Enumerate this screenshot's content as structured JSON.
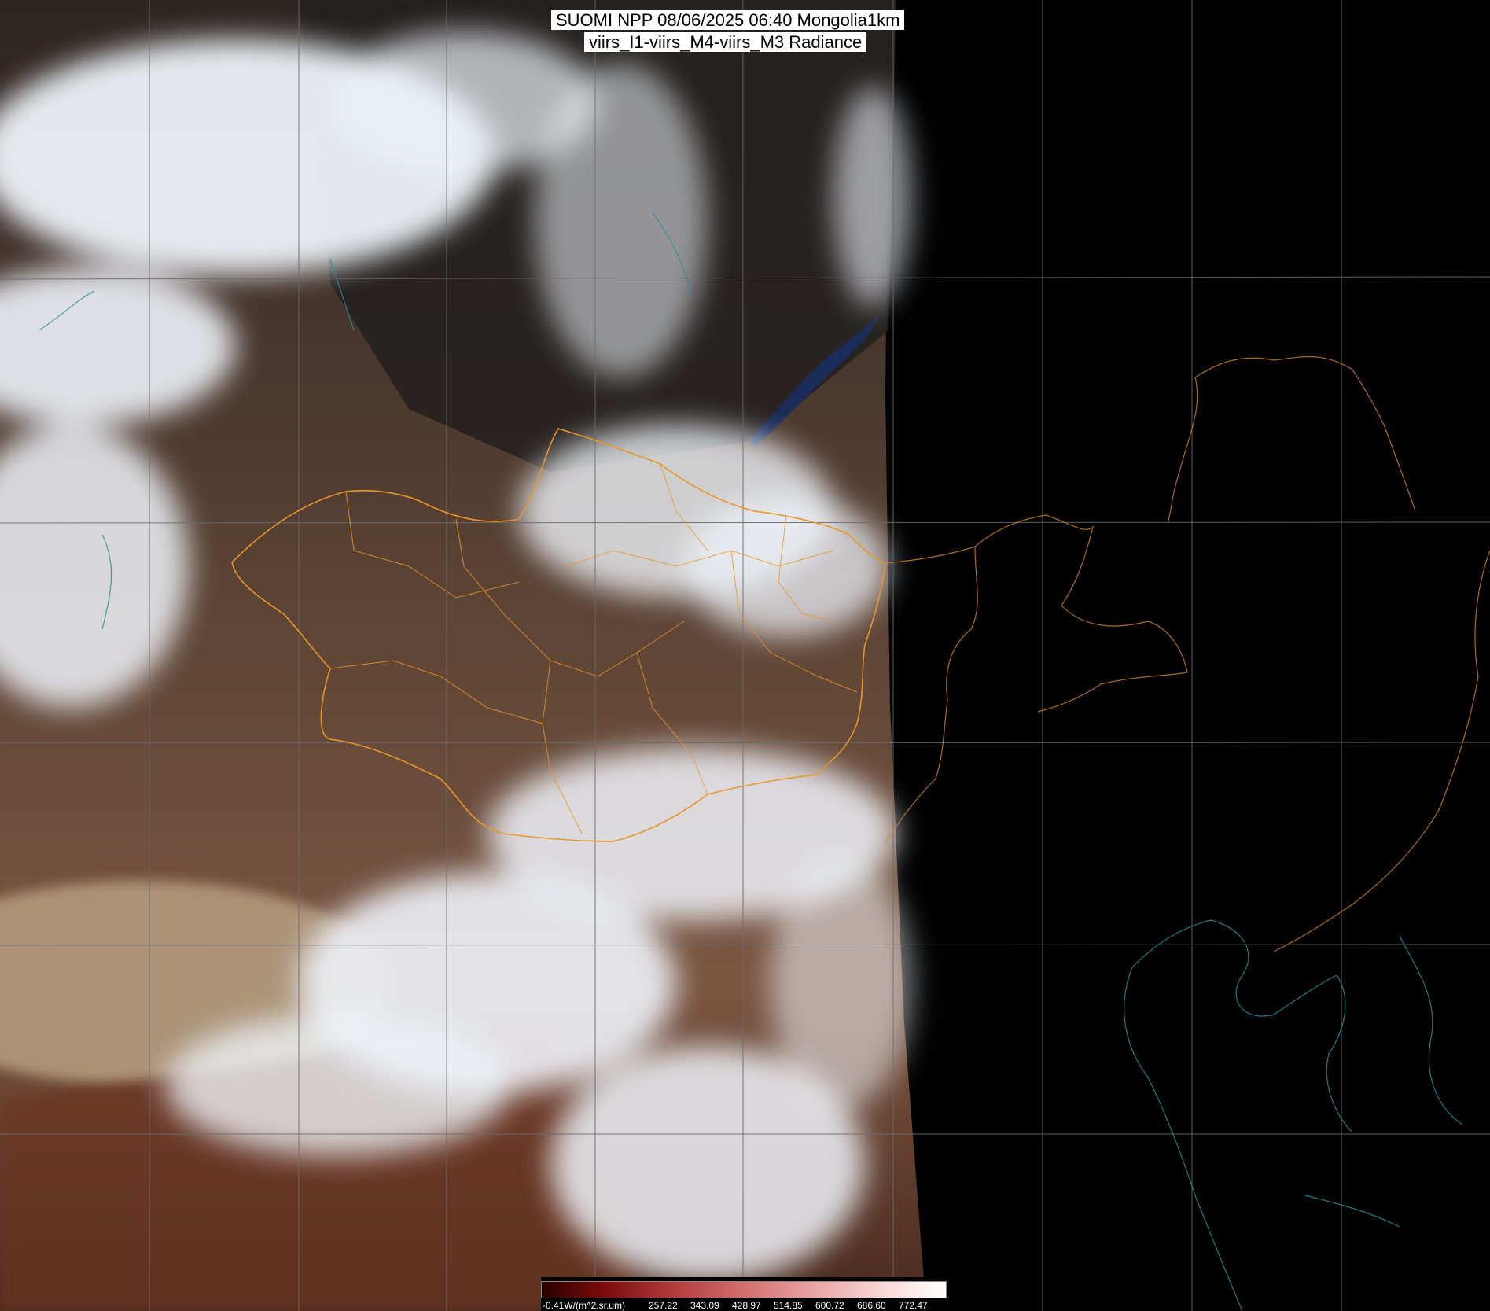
{
  "header": {
    "title_line1": "SUOMI NPP 08/06/2025 06:40 Mongolia1km",
    "title_line2": "viirs_I1-viirs_M4-viirs_M3 Radiance"
  },
  "colorbar": {
    "unit_label": "-0.41W/(m^2.sr.um)",
    "ticks": [
      "257.22",
      "343.09",
      "428.97",
      "514.85",
      "600.72",
      "686.60",
      "772.47"
    ]
  },
  "colors": {
    "background": "#000000",
    "boundary": "#e8962a",
    "grid": "#6b6b6b",
    "coastline": "#2b8d9a",
    "cloud": "#f4f7fb",
    "land": "#6e4a36"
  }
}
